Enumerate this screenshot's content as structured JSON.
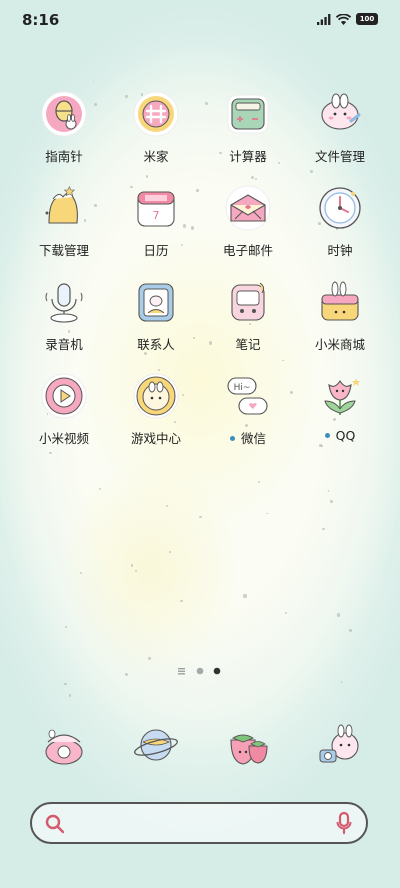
{
  "status_bar": {
    "time": "8:16",
    "battery": "100"
  },
  "apps": [
    {
      "name": "app-compass",
      "label": "指南针",
      "icon": "compass-bunny-icon",
      "dot": false
    },
    {
      "name": "app-mijia",
      "label": "米家",
      "icon": "mijia-icon",
      "dot": false
    },
    {
      "name": "app-calculator",
      "label": "计算器",
      "icon": "calculator-icon",
      "dot": false
    },
    {
      "name": "app-file-manager",
      "label": "文件管理",
      "icon": "folder-bunny-icon",
      "dot": false
    },
    {
      "name": "app-download-manager",
      "label": "下载管理",
      "icon": "download-icon",
      "dot": false
    },
    {
      "name": "app-calendar",
      "label": "日历",
      "icon": "calendar-icon",
      "dot": false
    },
    {
      "name": "app-email",
      "label": "电子邮件",
      "icon": "email-icon",
      "dot": false
    },
    {
      "name": "app-clock",
      "label": "时钟",
      "icon": "clock-icon",
      "dot": false
    },
    {
      "name": "app-recorder",
      "label": "录音机",
      "icon": "microphone-icon",
      "dot": false
    },
    {
      "name": "app-contacts",
      "label": "联系人",
      "icon": "contacts-icon",
      "dot": false
    },
    {
      "name": "app-notes",
      "label": "笔记",
      "icon": "notes-icon",
      "dot": false
    },
    {
      "name": "app-mi-store",
      "label": "小米商城",
      "icon": "shop-bag-icon",
      "dot": false
    },
    {
      "name": "app-mi-video",
      "label": "小米视频",
      "icon": "video-play-icon",
      "dot": false
    },
    {
      "name": "app-game-center",
      "label": "游戏中心",
      "icon": "game-center-icon",
      "dot": false
    },
    {
      "name": "app-wechat",
      "label": "微信",
      "icon": "wechat-bubbles-icon",
      "dot": true
    },
    {
      "name": "app-qq",
      "label": "QQ",
      "icon": "tulip-icon",
      "dot": true
    }
  ],
  "dock": [
    {
      "name": "dock-phone",
      "icon": "phone-icon"
    },
    {
      "name": "dock-browser",
      "icon": "planet-icon"
    },
    {
      "name": "dock-gallery",
      "icon": "strawberry-icon"
    },
    {
      "name": "dock-camera",
      "icon": "camera-bunny-icon"
    }
  ],
  "colors": {
    "accent_pink": "#f3a0b8",
    "accent_yellow": "#f7d77a",
    "accent_blue": "#8fb9e0",
    "dot_blue": "#3b8fb8"
  }
}
